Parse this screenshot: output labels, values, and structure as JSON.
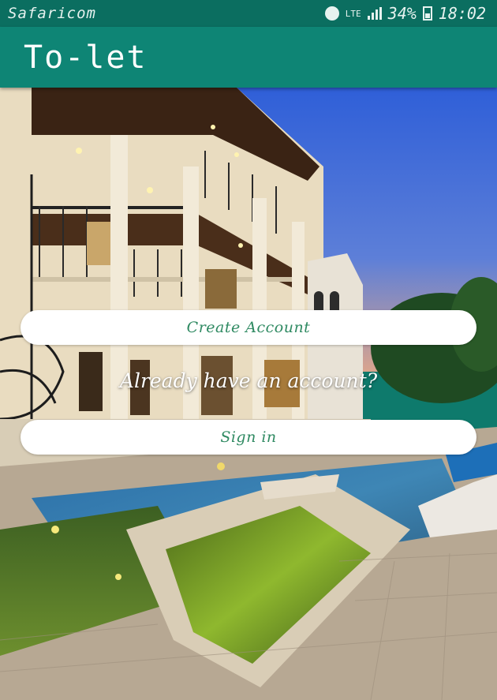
{
  "status_bar": {
    "carrier": "Safaricom",
    "network": "LTE",
    "battery": "34%",
    "time": "18:02",
    "icons": [
      "alarm-icon",
      "signal-icon",
      "battery-icon"
    ]
  },
  "app_bar": {
    "title": "To-let"
  },
  "main": {
    "create_account_label": "Create Account",
    "already_text": "Already have an account?",
    "sign_in_label": "Sign in"
  },
  "colors": {
    "status_bar": "#0b6e60",
    "app_bar": "#0e8575",
    "button_text": "#2f8a62",
    "button_bg": "#ffffff"
  }
}
